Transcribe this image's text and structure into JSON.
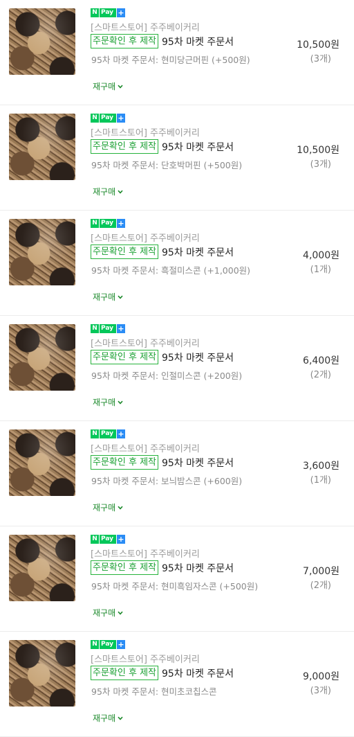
{
  "orders": [
    {
      "seller": "[스마트스토어] 주주베이커리",
      "badge": "주문확인 후 제작",
      "title": "95차 마켓 주문서",
      "option": "95차 마켓 주문서: 현미당근머핀 (+500원)",
      "price": "10,500원",
      "qty": "(3개)",
      "repurchase": "재구매"
    },
    {
      "seller": "[스마트스토어] 주주베이커리",
      "badge": "주문확인 후 제작",
      "title": "95차 마켓 주문서",
      "option": "95차 마켓 주문서: 단호박머핀 (+500원)",
      "price": "10,500원",
      "qty": "(3개)",
      "repurchase": "재구매"
    },
    {
      "seller": "[스마트스토어] 주주베이커리",
      "badge": "주문확인 후 제작",
      "title": "95차 마켓 주문서",
      "option": "95차 마켓 주문서: 흑절미스콘 (+1,000원)",
      "price": "4,000원",
      "qty": "(1개)",
      "repurchase": "재구매"
    },
    {
      "seller": "[스마트스토어] 주주베이커리",
      "badge": "주문확인 후 제작",
      "title": "95차 마켓 주문서",
      "option": "95차 마켓 주문서: 인절미스콘 (+200원)",
      "price": "6,400원",
      "qty": "(2개)",
      "repurchase": "재구매"
    },
    {
      "seller": "[스마트스토어] 주주베이커리",
      "badge": "주문확인 후 제작",
      "title": "95차 마켓 주문서",
      "option": "95차 마켓 주문서: 보늬밤스콘 (+600원)",
      "price": "3,600원",
      "qty": "(1개)",
      "repurchase": "재구매"
    },
    {
      "seller": "[스마트스토어] 주주베이커리",
      "badge": "주문확인 후 제작",
      "title": "95차 마켓 주문서",
      "option": "95차 마켓 주문서: 현미흑임자스콘 (+500원)",
      "price": "7,000원",
      "qty": "(2개)",
      "repurchase": "재구매"
    },
    {
      "seller": "[스마트스토어] 주주베이커리",
      "badge": "주문확인 후 제작",
      "title": "95차 마켓 주문서",
      "option": "95차 마켓 주문서: 현미초코칩스콘",
      "price": "9,000원",
      "qty": "(3개)",
      "repurchase": "재구매"
    }
  ],
  "npay": {
    "n": "N",
    "pay": "Pay",
    "plus": "+"
  },
  "colors": {
    "npay_green": "#03c75a",
    "npay_plus_blue": "#2a8cf5",
    "badge_green": "#1aa032",
    "repurchase_green": "#1d8a2c"
  },
  "icons": {
    "repurchase": "chevron-down-icon",
    "thumbnail": "product-photo"
  }
}
